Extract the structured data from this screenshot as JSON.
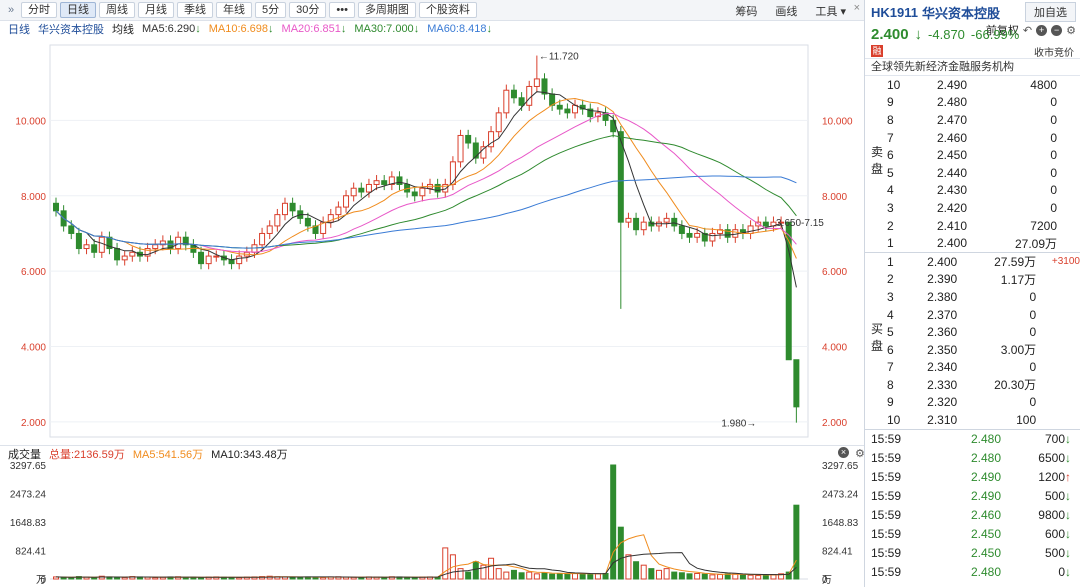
{
  "toolbar": {
    "periods": [
      "分时",
      "日线",
      "周线",
      "月线",
      "季线",
      "年线",
      "5分",
      "30分",
      "•••",
      "多周期图",
      "个股资料"
    ],
    "active_index": 1,
    "right": [
      "筹码",
      "画线",
      "工具 ▾"
    ]
  },
  "ma_line": {
    "label": "日线",
    "stock": "华兴资本控股",
    "avg": "均线",
    "items": [
      {
        "text": "MA5:6.290",
        "color": "#333333",
        "arrow": "↓"
      },
      {
        "text": "MA10:6.698",
        "color": "#f08c1e",
        "arrow": "↓"
      },
      {
        "text": "MA20:6.851",
        "color": "#e858c8",
        "arrow": "↓"
      },
      {
        "text": "MA30:7.000",
        "color": "#2f8a2f",
        "arrow": "↓"
      },
      {
        "text": "MA60:8.418",
        "color": "#3a7bd5",
        "arrow": "↓"
      }
    ],
    "adjust": "前复权"
  },
  "chart_data": {
    "type": "candlestick",
    "y_ticks": [
      "10.000",
      "8.000",
      "6.000",
      "4.000",
      "2.000"
    ],
    "annotations": {
      "high": "←11.720",
      "low": "1.980→",
      "right_label": "3.650-7.15"
    },
    "ylim": [
      1.6,
      12.0
    ],
    "closes": [
      7.6,
      7.2,
      7.0,
      6.6,
      6.7,
      6.5,
      6.9,
      6.6,
      6.3,
      6.4,
      6.5,
      6.4,
      6.6,
      6.7,
      6.8,
      6.6,
      6.9,
      6.7,
      6.5,
      6.2,
      6.4,
      6.4,
      6.3,
      6.2,
      6.4,
      6.5,
      6.7,
      7.0,
      7.2,
      7.5,
      7.8,
      7.6,
      7.4,
      7.2,
      7.0,
      7.3,
      7.5,
      7.7,
      8.0,
      8.2,
      8.1,
      8.3,
      8.4,
      8.3,
      8.5,
      8.3,
      8.1,
      8.0,
      8.2,
      8.3,
      8.1,
      8.3,
      8.9,
      9.6,
      9.4,
      9.0,
      9.3,
      9.7,
      10.2,
      10.8,
      10.6,
      10.4,
      10.9,
      11.1,
      10.7,
      10.4,
      10.3,
      10.2,
      10.4,
      10.3,
      10.1,
      10.2,
      10.0,
      9.7,
      7.3,
      7.4,
      7.1,
      7.3,
      7.2,
      7.3,
      7.4,
      7.2,
      7.0,
      6.9,
      7.0,
      6.8,
      7.0,
      7.1,
      6.9,
      7.1,
      7.0,
      7.2,
      7.3,
      7.2,
      7.3,
      7.3,
      3.65,
      2.4
    ],
    "volume_ticks": [
      "3297.65",
      "2473.24",
      "1648.83",
      "824.41",
      "0"
    ],
    "volume_unit": "万",
    "volumes": [
      60,
      50,
      40,
      70,
      55,
      45,
      80,
      60,
      50,
      45,
      70,
      60,
      55,
      40,
      50,
      60,
      65,
      45,
      50,
      40,
      55,
      60,
      50,
      45,
      40,
      55,
      60,
      70,
      80,
      65,
      60,
      50,
      55,
      60,
      50,
      45,
      60,
      65,
      55,
      50,
      45,
      60,
      55,
      50,
      65,
      60,
      50,
      45,
      55,
      60,
      50,
      900,
      700,
      300,
      200,
      500,
      400,
      600,
      300,
      200,
      250,
      180,
      200,
      150,
      180,
      140,
      160,
      150,
      170,
      140,
      130,
      150,
      160,
      3300,
      1500,
      700,
      500,
      400,
      300,
      250,
      300,
      200,
      180,
      150,
      160,
      140,
      120,
      130,
      150,
      140,
      120,
      110,
      100,
      120,
      130,
      150,
      200,
      2136.59
    ]
  },
  "vol_header": {
    "label": "成交量",
    "total": "总量:2136.59万",
    "ma5": "MA5:541.56万",
    "ma10": "MA10:343.48万"
  },
  "panel": {
    "code": "HK1911",
    "name": "华兴资本控股",
    "add": "加自选",
    "price": "2.400",
    "change": "-4.870",
    "pct": "-66.99%",
    "badge": "融",
    "auction": "收市竞价",
    "desc": "全球领先新经济金融服务机构",
    "sell_label": "卖盘",
    "buy_label": "买盘",
    "sell": [
      {
        "lv": "10",
        "p": "2.490",
        "q": "4800"
      },
      {
        "lv": "9",
        "p": "2.480",
        "q": "0"
      },
      {
        "lv": "8",
        "p": "2.470",
        "q": "0"
      },
      {
        "lv": "7",
        "p": "2.460",
        "q": "0"
      },
      {
        "lv": "6",
        "p": "2.450",
        "q": "0"
      },
      {
        "lv": "5",
        "p": "2.440",
        "q": "0"
      },
      {
        "lv": "4",
        "p": "2.430",
        "q": "0"
      },
      {
        "lv": "3",
        "p": "2.420",
        "q": "0"
      },
      {
        "lv": "2",
        "p": "2.410",
        "q": "7200"
      },
      {
        "lv": "1",
        "p": "2.400",
        "q": "27.09万"
      }
    ],
    "buy": [
      {
        "lv": "1",
        "p": "2.400",
        "q": "27.59万",
        "ex": "+3100"
      },
      {
        "lv": "2",
        "p": "2.390",
        "q": "1.17万",
        "ex": ""
      },
      {
        "lv": "3",
        "p": "2.380",
        "q": "0",
        "ex": ""
      },
      {
        "lv": "4",
        "p": "2.370",
        "q": "0",
        "ex": ""
      },
      {
        "lv": "5",
        "p": "2.360",
        "q": "0",
        "ex": ""
      },
      {
        "lv": "6",
        "p": "2.350",
        "q": "3.00万",
        "ex": ""
      },
      {
        "lv": "7",
        "p": "2.340",
        "q": "0",
        "ex": ""
      },
      {
        "lv": "8",
        "p": "2.330",
        "q": "20.30万",
        "ex": ""
      },
      {
        "lv": "9",
        "p": "2.320",
        "q": "0",
        "ex": ""
      },
      {
        "lv": "10",
        "p": "2.310",
        "q": "100",
        "ex": ""
      }
    ],
    "ticks": [
      {
        "t": "15:59",
        "p": "2.480",
        "v": "700",
        "d": "dn"
      },
      {
        "t": "15:59",
        "p": "2.480",
        "v": "6500",
        "d": "dn"
      },
      {
        "t": "15:59",
        "p": "2.490",
        "v": "1200",
        "d": "up"
      },
      {
        "t": "15:59",
        "p": "2.490",
        "v": "500",
        "d": "dn"
      },
      {
        "t": "15:59",
        "p": "2.460",
        "v": "9800",
        "d": "dn"
      },
      {
        "t": "15:59",
        "p": "2.450",
        "v": "600",
        "d": "dn"
      },
      {
        "t": "15:59",
        "p": "2.450",
        "v": "500",
        "d": "dn"
      },
      {
        "t": "15:59",
        "p": "2.480",
        "v": "0",
        "d": "dn"
      }
    ]
  }
}
